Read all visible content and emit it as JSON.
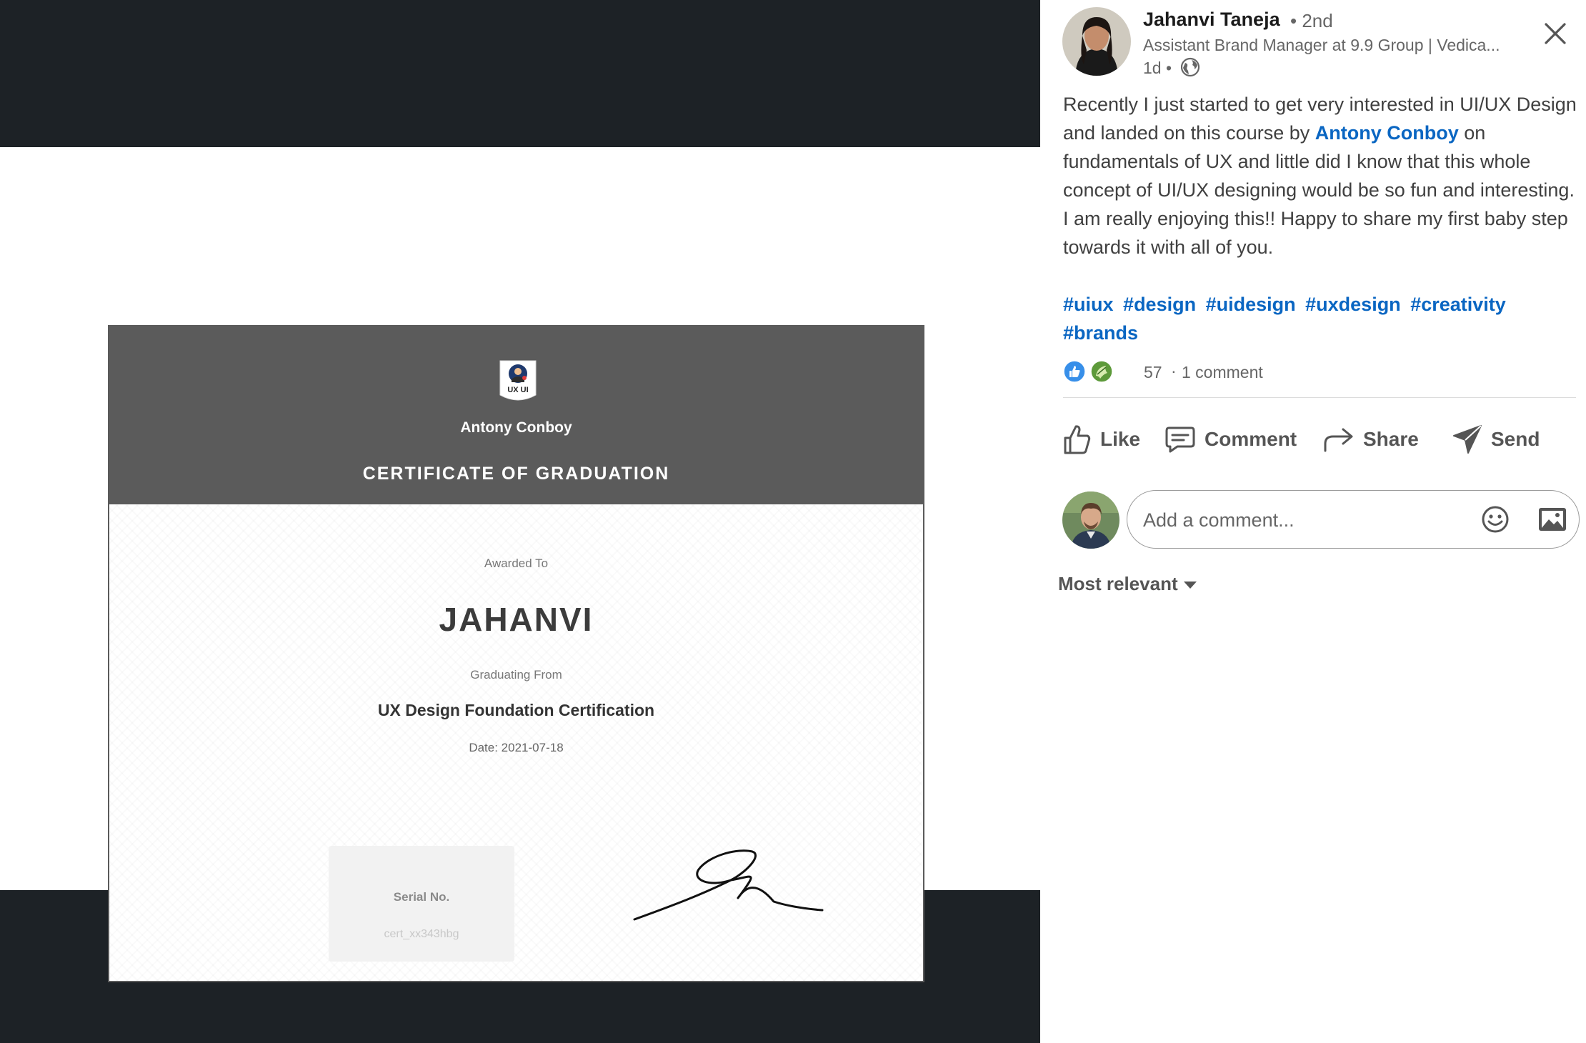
{
  "certificate": {
    "logo_text": "UX UI",
    "brand": "Antony Conboy",
    "title": "CERTIFICATE OF GRADUATION",
    "awarded_label": "Awarded To",
    "recipient": "JAHANVI",
    "graduating_label": "Graduating From",
    "course": "UX Design Foundation Certification",
    "date": "Date: 2021-07-18",
    "serial_label": "Serial No.",
    "serial_value": "cert_xx343hbg"
  },
  "post": {
    "author_name": "Jahanvi Taneja",
    "degree": "• 2nd",
    "headline": "Assistant Brand Manager at 9.9 Group | Vedica...",
    "time": "1d •",
    "text_before": "Recently I just started to get very interested in UI/UX Design and landed on this course by ",
    "mention": "Antony Conboy",
    "text_after": " on fundamentals of UX and little did I know that this whole concept of UI/UX designing would be so fun and interesting. I am really enjoying this!! Happy to share my first baby step towards it with all of you.",
    "hashtags": [
      "#uiux",
      "#design",
      "#uidesign",
      "#uxdesign",
      "#creativity",
      "#brands"
    ],
    "reaction_count": "57",
    "reaction_sep": "·",
    "comment_count": "1 comment"
  },
  "actions": {
    "like": "Like",
    "comment": "Comment",
    "share": "Share",
    "send": "Send"
  },
  "comment_box": {
    "placeholder": "Add a comment..."
  },
  "sort": {
    "label": "Most relevant"
  },
  "icons": {
    "close": "close-icon",
    "globe": "globe-icon",
    "like": "thumbs-up-icon",
    "comment": "comment-bubble-icon",
    "share": "share-arrow-icon",
    "send": "paper-plane-icon",
    "emoji": "smiley-icon",
    "image": "image-icon"
  },
  "colors": {
    "link": "#0a66c2",
    "media_background": "#1d2226",
    "certificate_header": "#5b5b5b"
  }
}
